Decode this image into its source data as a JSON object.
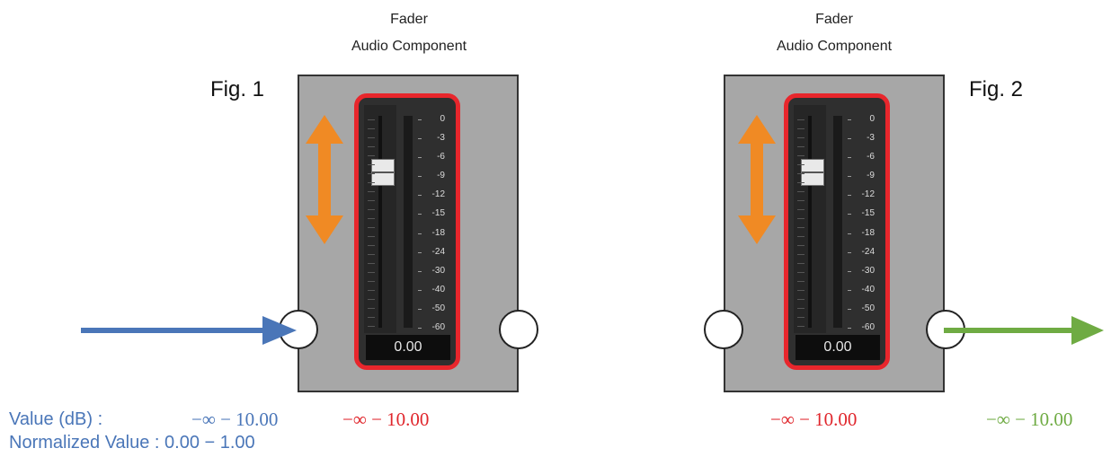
{
  "figures": [
    {
      "label": "Fig. 1",
      "title": "Fader",
      "subtitle": "Audio Component",
      "value_display": "0.00"
    },
    {
      "label": "Fig. 2",
      "title": "Fader",
      "subtitle": "Audio Component",
      "value_display": "0.00"
    }
  ],
  "scale_marks": [
    "0",
    "-3",
    "-6",
    "-9",
    "-12",
    "-15",
    "-18",
    "-24",
    "-30",
    "-40",
    "-50",
    "-60"
  ],
  "ranges": {
    "fig1_input": "−∞ − 10.00",
    "fig1_fader": "−∞ − 10.00",
    "fig2_fader": "−∞ − 10.00",
    "fig2_output": "−∞ − 10.00"
  },
  "info": {
    "value_db_label": "Value (dB) :",
    "normalized_label": "Normalized Value : 0.00 − 1.00"
  },
  "colors": {
    "panel": "#a7a7a7",
    "highlight": "#e8262c",
    "drag_arrow": "#f08a24",
    "input_arrow": "#4a76b8",
    "output_arrow": "#6fab43"
  }
}
